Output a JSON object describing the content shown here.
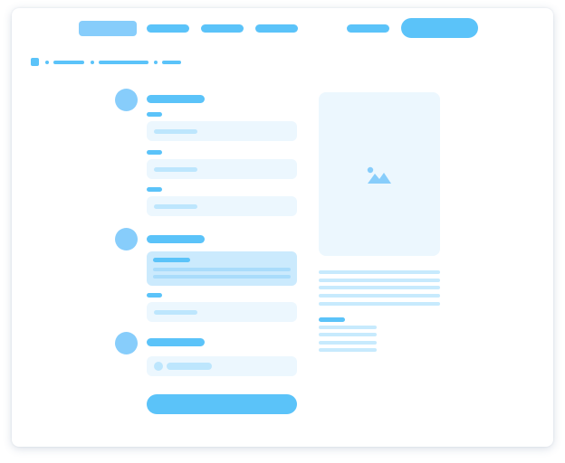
{
  "colors": {
    "accent": "#5bc3f9",
    "accent_soft": "#87cdfb",
    "field_bg": "#ecf7fe",
    "line_light": "#bde6fd",
    "selected_bg": "#cbeafd",
    "shadow": "#d9e3ec"
  },
  "header": {
    "logo_icon": "logo-placeholder",
    "nav_item_count": 3,
    "cta_button_icon": "button-placeholder"
  },
  "breadcrumb": {
    "home_icon": "home-square-icon",
    "levels": 3
  },
  "checkout_steps": [
    {
      "step_marker": "circle",
      "fields": 3
    },
    {
      "step_marker": "circle",
      "options": 1,
      "selected_option": 1,
      "fields": 1
    },
    {
      "step_marker": "circle",
      "toggle_rows": 1
    }
  ],
  "product_panel": {
    "image_icon": "image-placeholder-icon",
    "description_lines": 5,
    "spec_lines": 4
  }
}
